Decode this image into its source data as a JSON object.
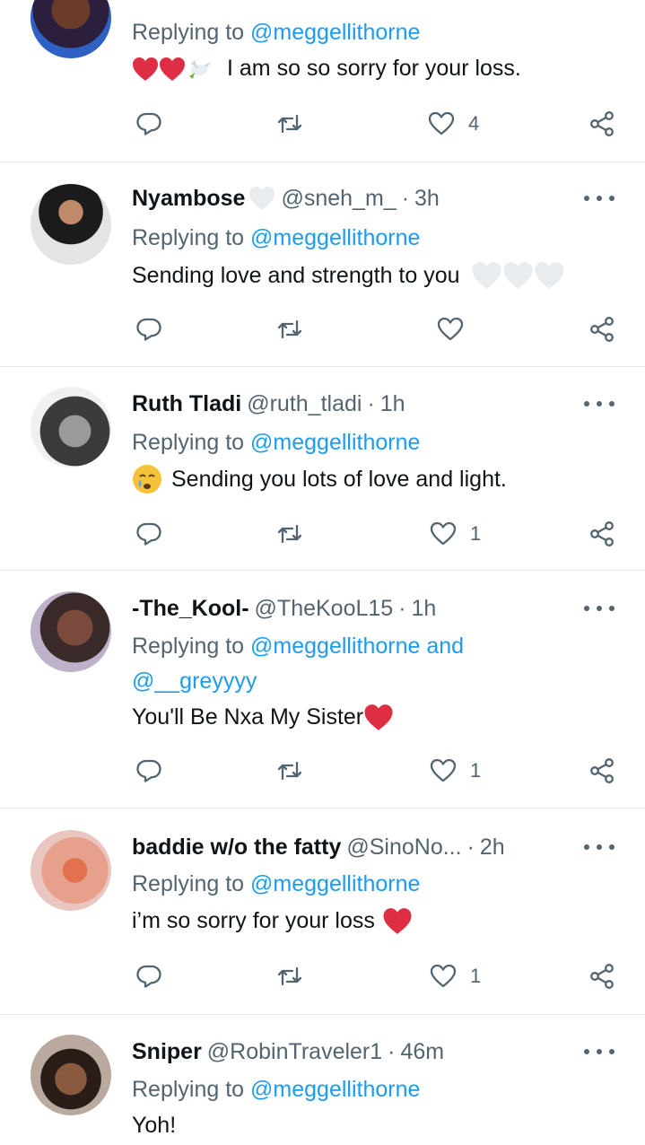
{
  "tweets": [
    {
      "name": "",
      "handle": "",
      "time": "",
      "replying_prefix": "Replying to",
      "replying_to": "@meggellithorne",
      "replying_to_line2": "",
      "text": "I am so so sorry for your loss.",
      "emojis_before": "red-hearts-and-dove",
      "emojis_after": "",
      "likes": "4"
    },
    {
      "name": "Nyambose",
      "handle": "@sneh_m_",
      "time": "3h",
      "replying_prefix": "Replying to",
      "replying_to": "@meggellithorne",
      "replying_to_line2": "",
      "text": "Sending love and strength to you",
      "emojis_before": "",
      "emojis_after": "three-white-hearts",
      "likes": ""
    },
    {
      "name": "Ruth Tladi",
      "handle": "@ruth_tladi",
      "time": "1h",
      "replying_prefix": "Replying to",
      "replying_to": "@meggellithorne",
      "replying_to_line2": "",
      "text": "Sending you lots of love and light.",
      "emojis_before": "crying-face",
      "emojis_after": "",
      "likes": "1"
    },
    {
      "name": "-The_Kool-",
      "handle": "@TheKooL15",
      "time": "1h",
      "replying_prefix": "Replying to",
      "replying_to": "@meggellithorne and",
      "replying_to_line2": "@__greyyyy",
      "text": "You'll Be Nxa My Sister",
      "emojis_before": "",
      "emojis_after": "red-heart",
      "likes": "1"
    },
    {
      "name": "baddie w/o the fatty",
      "handle": "@SinoNo...",
      "time": "2h",
      "replying_prefix": "Replying to",
      "replying_to": "@meggellithorne",
      "replying_to_line2": "",
      "text": "i’m so sorry for your loss",
      "emojis_before": "",
      "emojis_after": "red-heart",
      "likes": "1"
    },
    {
      "name": "Sniper",
      "handle": "@RobinTraveler1",
      "time": "46m",
      "replying_prefix": "Replying to",
      "replying_to": "@meggellithorne",
      "replying_to_line2": "",
      "text": "Yoh!",
      "emojis_before": "",
      "emojis_after": "",
      "likes": ""
    }
  ],
  "colors": {
    "link": "#1d9bf0",
    "muted": "#536471",
    "text": "#0f1419",
    "divider": "#e6e9eb",
    "heart_red": "#dd2e44"
  },
  "icons": [
    "reply-icon",
    "retweet-icon",
    "like-icon",
    "share-icon",
    "more-icon"
  ]
}
